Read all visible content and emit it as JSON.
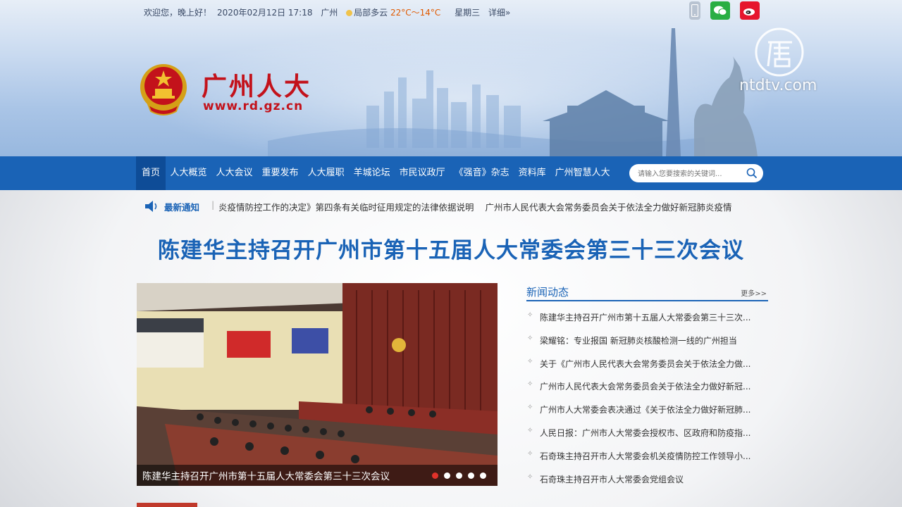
{
  "topbar": {
    "greeting": "欢迎您，晚上好！",
    "datetime": "2020年02月12日 17:18",
    "city": "广州",
    "weather": "局部多云",
    "temperature": "22°C～14°C",
    "weekday": "星期三",
    "details_link": "详细»"
  },
  "social": {
    "icons": [
      "mobile-phone-icon",
      "wechat-icon",
      "weibo-icon"
    ]
  },
  "brand": {
    "title": "广州人大",
    "url": "www.rd.gz.cn"
  },
  "watermark": {
    "text": "ntdtv.com"
  },
  "nav": {
    "items": [
      "首页",
      "人大概览",
      "人大会议",
      "重要发布",
      "人大履职",
      "羊城论坛",
      "市民议政厅",
      "《强音》杂志",
      "资料库",
      "广州智慧人大"
    ],
    "active_index": 0
  },
  "search": {
    "placeholder": "请输入您要搜索的关键词..."
  },
  "notice": {
    "label": "最新通知",
    "separator": "|",
    "items": [
      "炎疫情防控工作的决定》第四条有关临时征用规定的法律依据说明",
      "广州市人民代表大会常务委员会关于依法全力做好新冠肺炎疫情"
    ]
  },
  "headline": "陈建华主持召开广州市第十五届人大常委会第三十三次会议",
  "slideshow": {
    "caption": "陈建华主持召开广州市第十五届人大常委会第三十三次会议",
    "slide_count": 5,
    "active_slide": 1
  },
  "news": {
    "title": "新闻动态",
    "more": "更多>>",
    "items": [
      "陈建华主持召开广州市第十五届人大常委会第三十三次...",
      "梁耀铭：专业报国 新冠肺炎核酸检测一线的广州担当",
      "关于《广州市人民代表大会常务委员会关于依法全力做...",
      "广州市人民代表大会常务委员会关于依法全力做好新冠...",
      "广州市人大常委会表决通过《关于依法全力做好新冠肺...",
      "人民日报：广州市人大常委会授权市、区政府和防疫指...",
      "石奇珠主持召开市人大常委会机关疫情防控工作领导小...",
      "石奇珠主持召开市人大常委会党组会议"
    ]
  },
  "colors": {
    "nav_bg": "#1a63b6",
    "brand_red": "#c3121b",
    "headline_blue": "#1a63b6",
    "active_dot": "#e0322a"
  }
}
